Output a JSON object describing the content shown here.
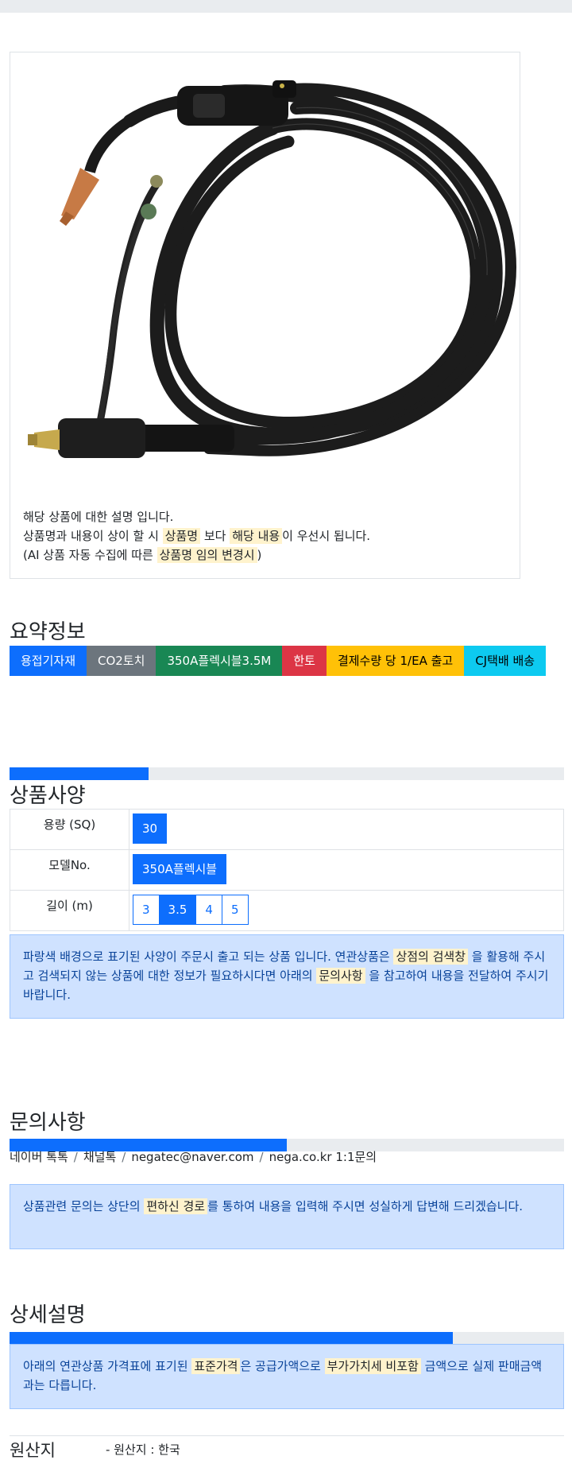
{
  "product": {
    "image_alt": "CO2 welding torch with coiled black hose",
    "desc_line1": "해당 상품에 대한 설명 입니다.",
    "desc_line2_a": "상품명과 내용이 상이 할 시 ",
    "desc_line2_mark1": "상품명",
    "desc_line2_b": " 보다 ",
    "desc_line2_mark2": "해당 내용",
    "desc_line2_c": "이 우선시 됩니다.",
    "desc_line3_a": "(AI 상품 자동 수집에 따른 ",
    "desc_line3_mark": "상품명 임의 변경시",
    "desc_line3_b": ")"
  },
  "summary": {
    "title": "요약정보",
    "badges": [
      {
        "label": "용접기자재",
        "color": "#0d6efd",
        "text": "#ffffff"
      },
      {
        "label": "CO2토치",
        "color": "#6c757d",
        "text": "#ffffff"
      },
      {
        "label": "350A플렉시블3.5M",
        "color": "#198754",
        "text": "#ffffff"
      },
      {
        "label": "한토",
        "color": "#dc3545",
        "text": "#ffffff"
      },
      {
        "label": "결제수량 당 1/EA 출고",
        "color": "#ffc107",
        "text": "#000000"
      },
      {
        "label": "CJ택배 배송",
        "color": "#0dcaf0",
        "text": "#000000"
      }
    ]
  },
  "specs": {
    "title": "상품사양",
    "progress": 0.25,
    "rows": [
      {
        "label": "용량 (SQ)",
        "options": [
          "30"
        ],
        "selected": "30"
      },
      {
        "label": "모델No.",
        "options": [
          "350A플렉시블"
        ],
        "selected": "350A플렉시블"
      },
      {
        "label": "길이 (m)",
        "options": [
          "3",
          "3.5",
          "4",
          "5"
        ],
        "selected": "3.5"
      }
    ],
    "note_a": "파랑색 배경으로 표기된 사양이 주문시 출고 되는 상품 입니다. 연관상품은 ",
    "note_mark1": "상점의 검색창",
    "note_b": " 을 활용해 주시고 검색되지 않는 상품에 대한 정보가 필요하시다면 아래의 ",
    "note_mark2": "문의사항",
    "note_c": " 을 참고하여 내용을 전달하여 주시기 바랍니다."
  },
  "inquiry": {
    "title": "문의사항",
    "progress": 0.5,
    "contacts": [
      "네이버 톡톡",
      "채널톡",
      "negatec@naver.com",
      "nega.co.kr 1:1문의"
    ],
    "separator": "/",
    "note_a": "상품관련 문의는 상단의 ",
    "note_mark": "편하신 경로",
    "note_b": "를 통하여 내용을 입력해 주시면 성실하게 답변해 드리겠습니다."
  },
  "detail": {
    "title": "상세설명",
    "progress": 0.8,
    "note_a": "아래의 연관상품 가격표에 표기된 ",
    "note_mark1": "표준가격",
    "note_b": "은 공급가액으로 ",
    "note_mark2": "부가가치세 비포함",
    "note_c": " 금액으로 실제 판매금액과는 다릅니다."
  },
  "origin": {
    "title": "원산지",
    "value": "- 원산지 : 한국"
  }
}
